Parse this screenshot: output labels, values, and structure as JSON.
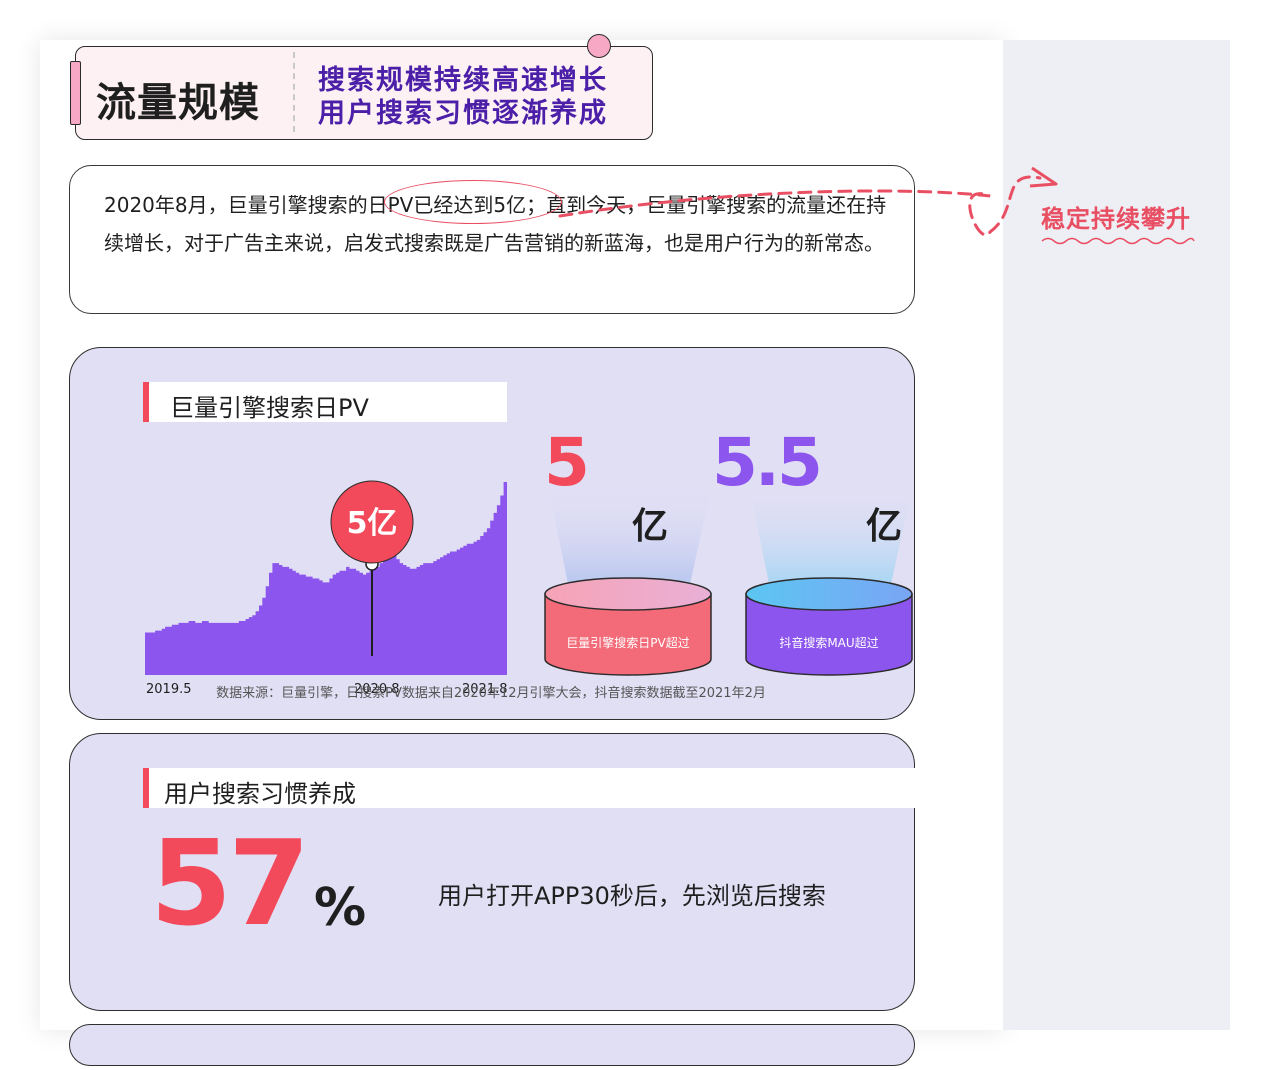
{
  "header": {
    "title": "流量规模",
    "subtitle_line1": "搜索规模持续高速增长",
    "subtitle_line2": "用户搜索习惯逐渐养成"
  },
  "intro": {
    "text": "2020年8月，巨量引擎搜索的日PV已经达到5亿；直到今天，巨量引擎搜索的流量还在持续增长，对于广告主来说，启发式搜索既是广告营销的新蓝海，也是用户行为的新常态。"
  },
  "annotation": {
    "text": "稳定持续攀升"
  },
  "pv_section": {
    "title": "巨量引擎搜索日PV",
    "pin_label": "5亿",
    "stat1_value": "5",
    "stat1_unit": "亿",
    "stat1_label": "巨量引擎搜索日PV超过",
    "stat2_value": "5.5",
    "stat2_unit": "亿",
    "stat2_label": "抖音搜索MAU超过",
    "source": "数据来源：巨量引擎，日搜索PV数据来自2020年12月引擎大会，抖音搜索数据截至2021年2月"
  },
  "chart_data": {
    "type": "area",
    "x_tick_labels": [
      "2019.5",
      "2020.8",
      "2021.8"
    ],
    "annotation": {
      "x": "2020.8",
      "label": "5亿"
    },
    "series": [
      {
        "values": [
          0.22,
          0.22,
          0.22,
          0.23,
          0.23,
          0.24,
          0.25,
          0.25,
          0.26,
          0.26,
          0.27,
          0.27,
          0.27,
          0.28,
          0.28,
          0.27,
          0.27,
          0.28,
          0.28,
          0.27,
          0.27,
          0.27,
          0.27,
          0.27,
          0.27,
          0.27,
          0.27,
          0.27,
          0.28,
          0.28,
          0.29,
          0.3,
          0.31,
          0.33,
          0.36,
          0.4,
          0.46,
          0.53,
          0.58,
          0.58,
          0.57,
          0.56,
          0.56,
          0.55,
          0.54,
          0.53,
          0.52,
          0.52,
          0.51,
          0.51,
          0.5,
          0.5,
          0.49,
          0.48,
          0.48,
          0.5,
          0.52,
          0.53,
          0.54,
          0.54,
          0.56,
          0.55,
          0.55,
          0.54,
          0.53,
          0.52,
          0.53,
          0.54,
          0.55,
          0.56,
          0.58,
          0.6,
          0.62,
          0.63,
          0.62,
          0.6,
          0.58,
          0.57,
          0.56,
          0.55,
          0.55,
          0.56,
          0.57,
          0.58,
          0.58,
          0.58,
          0.59,
          0.6,
          0.61,
          0.62,
          0.63,
          0.64,
          0.64,
          0.65,
          0.66,
          0.67,
          0.68,
          0.68,
          0.69,
          0.7,
          0.72,
          0.74,
          0.76,
          0.8,
          0.84,
          0.88,
          0.93,
          1.0
        ]
      }
    ]
  },
  "habit_section": {
    "title": "用户搜索习惯养成",
    "percent_value": "57",
    "percent_sign": "%",
    "description": "用户打开APP30秒后，先浏览后搜索"
  },
  "colors": {
    "accent_red": "#f24a5b",
    "accent_purple": "#8b55ee",
    "panel_bg": "#e1dff4",
    "header_text": "#4b1fa8"
  }
}
